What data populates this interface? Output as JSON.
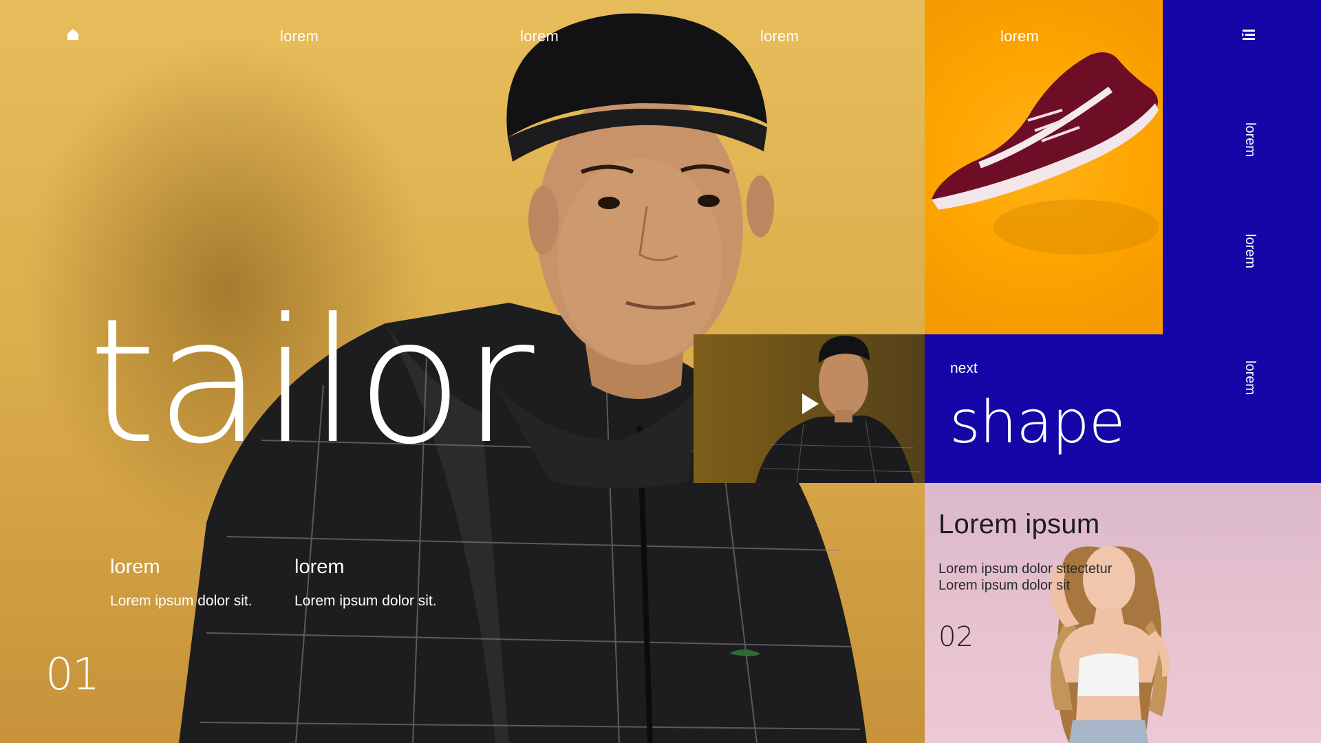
{
  "nav": {
    "home_icon": "home-icon",
    "links": [
      "lorem",
      "lorem",
      "lorem",
      "lorem"
    ],
    "menu_icon": "menu-icon"
  },
  "hero": {
    "title": "tailor",
    "columns": [
      {
        "label": "lorem",
        "text": "Lorem ipsum dolor sit."
      },
      {
        "label": "lorem",
        "text": "Lorem ipsum dolor sit."
      }
    ],
    "number": "01"
  },
  "sidebar": {
    "links": [
      "lorem",
      "lorem",
      "lorem"
    ]
  },
  "next": {
    "label": "next",
    "title": "shape"
  },
  "video": {
    "play_icon": "play-icon"
  },
  "card": {
    "title": "Lorem ipsum",
    "lines": [
      "Lorem ipsum dolor sitectetur",
      "Lorem ipsum dolor sit"
    ],
    "number": "02"
  },
  "colors": {
    "hero_yellow": "#dcae4c",
    "shoe_orange": "#ffa500",
    "blue": "#1506a8",
    "pink": "#e8c3d1",
    "text_white": "#ffffff"
  }
}
